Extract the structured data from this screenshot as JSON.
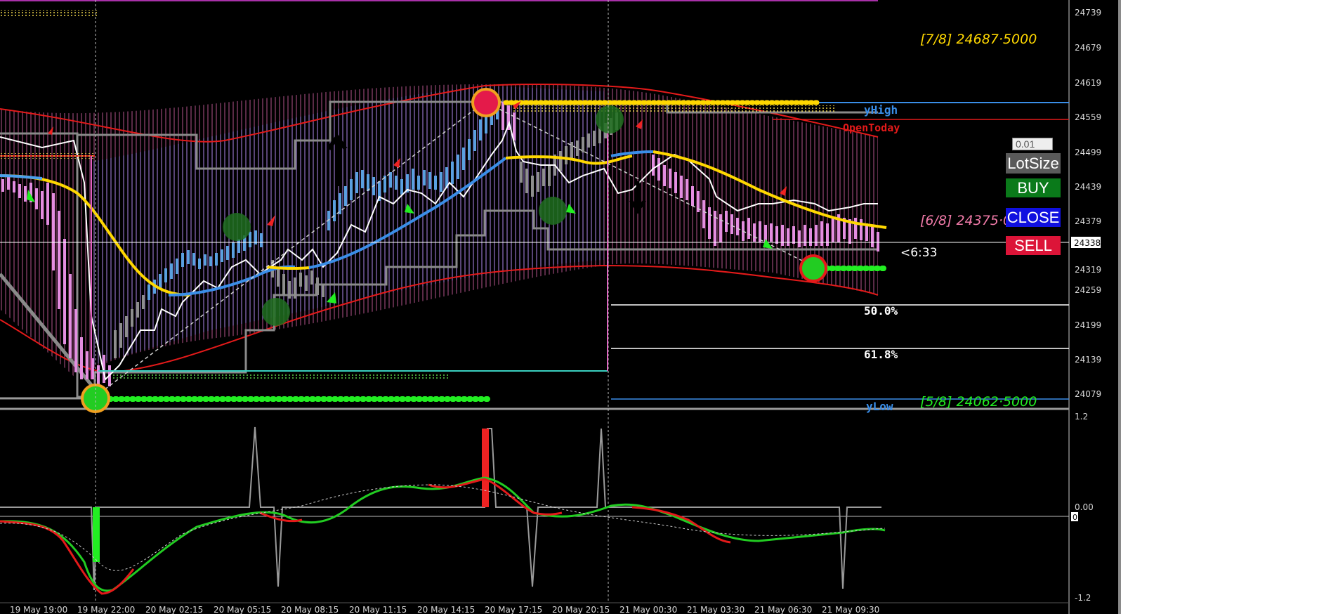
{
  "price_axis": {
    "labels": [
      "24739",
      "24679",
      "24619",
      "24559",
      "24499",
      "24439",
      "24379",
      "24319",
      "24259",
      "24199",
      "24139",
      "24079"
    ],
    "current_price": "24338"
  },
  "osc_axis": {
    "labels": [
      "1.2",
      "0.00",
      "-1.2"
    ],
    "zero_marker": "0"
  },
  "time_axis": {
    "labels": [
      "19 May 19:00",
      "19 May 22:00",
      "20 May 02:15",
      "20 May 05:15",
      "20 May 08:15",
      "20 May 11:15",
      "20 May 14:15",
      "20 May 17:15",
      "20 May 20:15",
      "21 May 00:30",
      "21 May 03:30",
      "21 May 06:30",
      "21 May 09:30"
    ]
  },
  "levels": {
    "murrey_7_8": "[7/8] 24687·5000",
    "murrey_6_8": "[6/8] 24375·0000",
    "murrey_5_8": "[5/8] 24062·5000",
    "yhigh": "yHigh",
    "ylow": "yLow",
    "open_today": "OpenToday",
    "fib_50": "50.0%",
    "fib_618": "61.8%",
    "countdown": "<6:33"
  },
  "controls": {
    "lot_value": "0.01",
    "lot_label": "LotSize",
    "buy_label": "BUY",
    "close_label": "CLOSE",
    "sell_label": "SELL"
  },
  "colors": {
    "buy": "#0a7a1a",
    "close": "#1010e0",
    "sell": "#dc1438",
    "lotsize_bg": "#5a5a5a"
  }
}
